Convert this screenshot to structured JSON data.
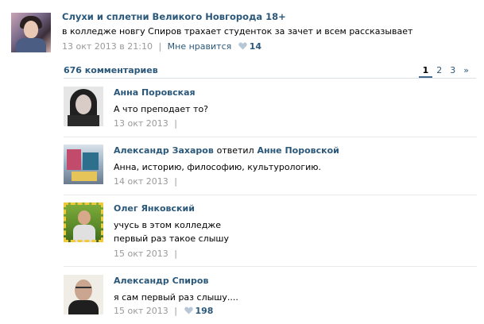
{
  "post": {
    "author": "Слухи и сплетни Великого Новгорода 18+",
    "text": "в колледже новгу Спиров трахает студенток за зачет и всем рассказывает",
    "date": "13 окт 2013 в 21:10",
    "like_label": "Мне нравится",
    "like_count": "14",
    "separator": "|"
  },
  "comments_header": "676 комментариев",
  "pager": {
    "pages": [
      "1",
      "2",
      "3"
    ],
    "next": "»",
    "active": "1"
  },
  "comments": [
    {
      "author": "Анна Поровская",
      "text": "А что преподает то?",
      "date": "13 окт 2013",
      "separator": "|"
    },
    {
      "author": "Александр Захаров",
      "reply_word": "ответил",
      "reply_to": "Анне Поровской",
      "text": "Анна, историю, философию, культурологию.",
      "date": "14 окт 2013",
      "separator": "|"
    },
    {
      "author": "Олег Янковский",
      "text_line1": "учусь в этом колледже",
      "text_line2": "первый раз такое слышу",
      "date": "15 окт 2013",
      "separator": "|"
    },
    {
      "author": "Александр Спиров",
      "text": "я сам первый раз слышу....",
      "date": "15 окт 2013",
      "separator": "|",
      "like_count": "198"
    }
  ],
  "colors": {
    "link": "#2b587a",
    "meta": "#999999",
    "heart": "#b8c7d6",
    "divider": "#e7eaed"
  },
  "icons": {
    "like": "heart-icon"
  }
}
